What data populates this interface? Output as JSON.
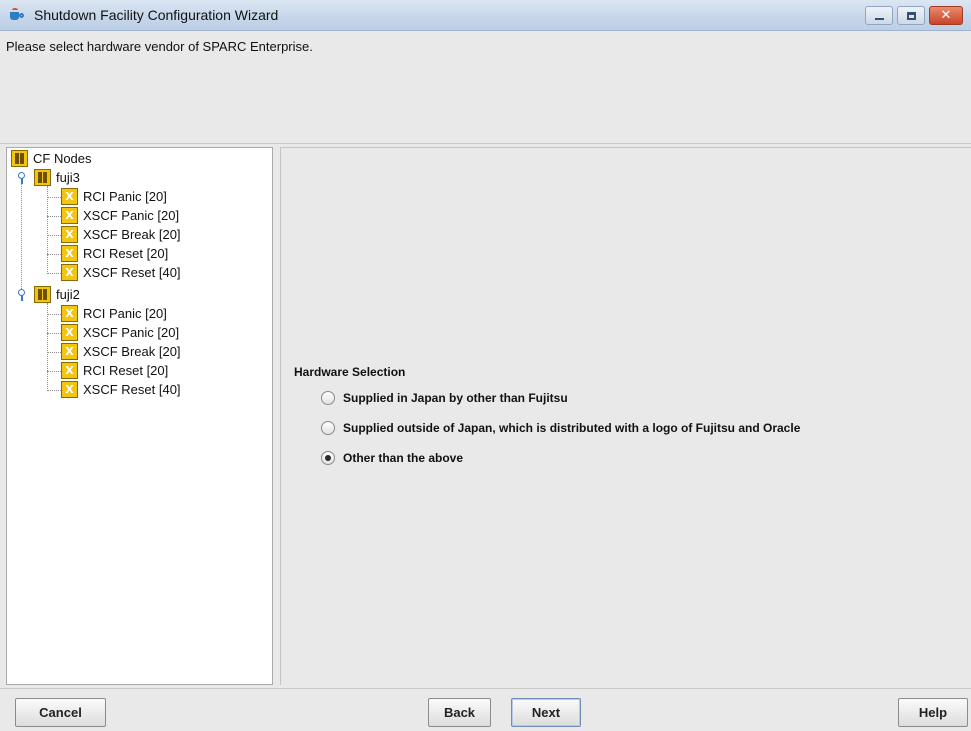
{
  "window": {
    "title": "Shutdown Facility Configuration Wizard"
  },
  "instruction": "Please select hardware vendor of SPARC Enterprise.",
  "tree": {
    "root": "CF Nodes",
    "nodes": [
      {
        "name": "fuji3",
        "children": [
          "RCI Panic [20]",
          "XSCF Panic [20]",
          "XSCF Break [20]",
          "RCI Reset [20]",
          "XSCF Reset [40]"
        ]
      },
      {
        "name": "fuji2",
        "children": [
          "RCI Panic [20]",
          "XSCF Panic [20]",
          "XSCF Break [20]",
          "RCI Reset [20]",
          "XSCF Reset [40]"
        ]
      }
    ]
  },
  "hardware_selection": {
    "title": "Hardware Selection",
    "options": [
      {
        "label": "Supplied in Japan by other than Fujitsu",
        "selected": false
      },
      {
        "label": "Supplied outside of Japan, which is distributed with a logo of Fujitsu and Oracle",
        "selected": false
      },
      {
        "label": "Other than the above",
        "selected": true
      }
    ]
  },
  "buttons": {
    "cancel": "Cancel",
    "back": "Back",
    "next": "Next",
    "help": "Help"
  },
  "colors": {
    "titlebar": "#c6d6ea",
    "panel_bg": "#e9e9ea",
    "tree_icon": "#f4c413",
    "close_button": "#c8442a"
  },
  "icons": {
    "app": "java-cup-icon",
    "node": "node-icon",
    "method": "shutdown-method-icon"
  }
}
